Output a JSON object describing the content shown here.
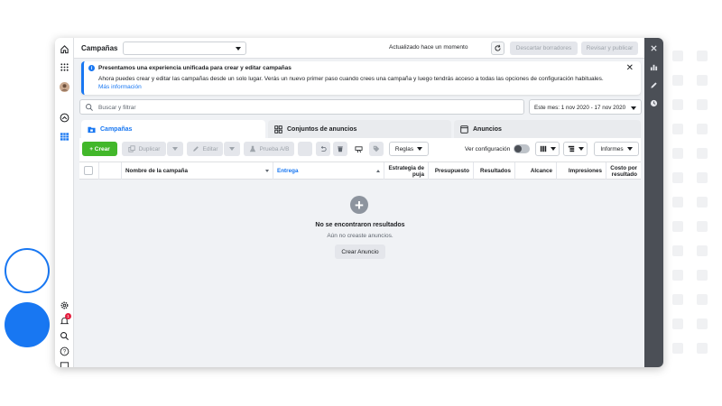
{
  "header": {
    "title": "Campañas",
    "campaign_select_value": "",
    "updated_text": "Actualizado hace un momento",
    "discard_label": "Descartar borradores",
    "publish_label": "Revisar y publicar",
    "more_label": "···"
  },
  "banner": {
    "title": "Presentamos una experiencia unificada para crear y editar campañas",
    "body": "Ahora puedes crear y editar las campañas desde un solo lugar. Verás un nuevo primer paso cuando crees una campaña y luego tendrás acceso a todas las opciones de configuración habituales.",
    "link": "Más información",
    "close": "✕"
  },
  "search": {
    "placeholder": "Buscar y filtrar"
  },
  "date_range": {
    "label": "Este mes: 1 nov 2020 - 17 nov 2020"
  },
  "tabs": [
    {
      "label": "Campañas"
    },
    {
      "label": "Conjuntos de anuncios"
    },
    {
      "label": "Anuncios"
    }
  ],
  "toolbar": {
    "create": "+ Crear",
    "duplicate": "Duplicar",
    "edit": "Editar",
    "ab_test": "Prueba A/B",
    "rules": "Reglas",
    "view_config": "Ver configuración",
    "reports": "Informes"
  },
  "table": {
    "columns": [
      "Nombre de la campaña",
      "Entrega",
      "Estrategia de puja",
      "Presupuesto",
      "Resultados",
      "Alcance",
      "Impresiones",
      "Costo por resultado"
    ]
  },
  "empty_state": {
    "title": "No se encontraron resultados",
    "subtitle": "Aún no creaste anuncios.",
    "button": "Crear Anuncio"
  },
  "notifications": {
    "badge": "1"
  },
  "colors": {
    "accent": "#1877f2",
    "create_green": "#42b72a",
    "rail": "#4b4f56"
  }
}
